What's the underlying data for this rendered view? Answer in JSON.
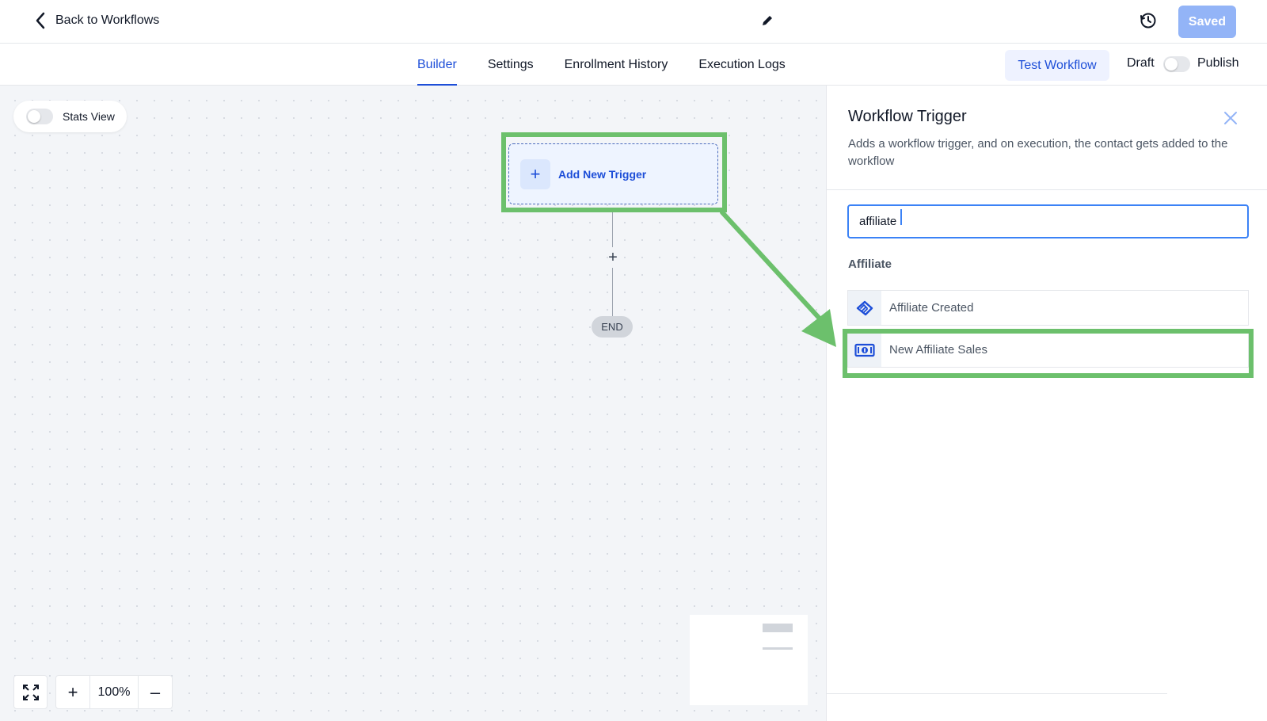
{
  "header": {
    "back_label": "Back to Workflows",
    "saved_label": "Saved"
  },
  "nav": {
    "tabs": [
      {
        "label": "Builder",
        "active": true
      },
      {
        "label": "Settings",
        "active": false
      },
      {
        "label": "Enrollment History",
        "active": false
      },
      {
        "label": "Execution Logs",
        "active": false
      }
    ],
    "test_label": "Test Workflow",
    "draft_label": "Draft",
    "publish_label": "Publish"
  },
  "canvas": {
    "stats_label": "Stats View",
    "trigger_label": "Add New Trigger",
    "end_label": "END",
    "zoom_value": "100%"
  },
  "panel": {
    "title": "Workflow Trigger",
    "description": "Adds a workflow trigger, and on execution, the contact gets added to the workflow",
    "search_value": "affiliate",
    "section_label": "Affiliate",
    "items": [
      {
        "label": "Affiliate Created",
        "icon": "handshake-icon"
      },
      {
        "label": "New Affiliate Sales",
        "icon": "money-icon"
      }
    ]
  },
  "colors": {
    "accent": "#1d4ed8",
    "highlight": "#6cc06c",
    "saved_button": "#93b4f7"
  }
}
